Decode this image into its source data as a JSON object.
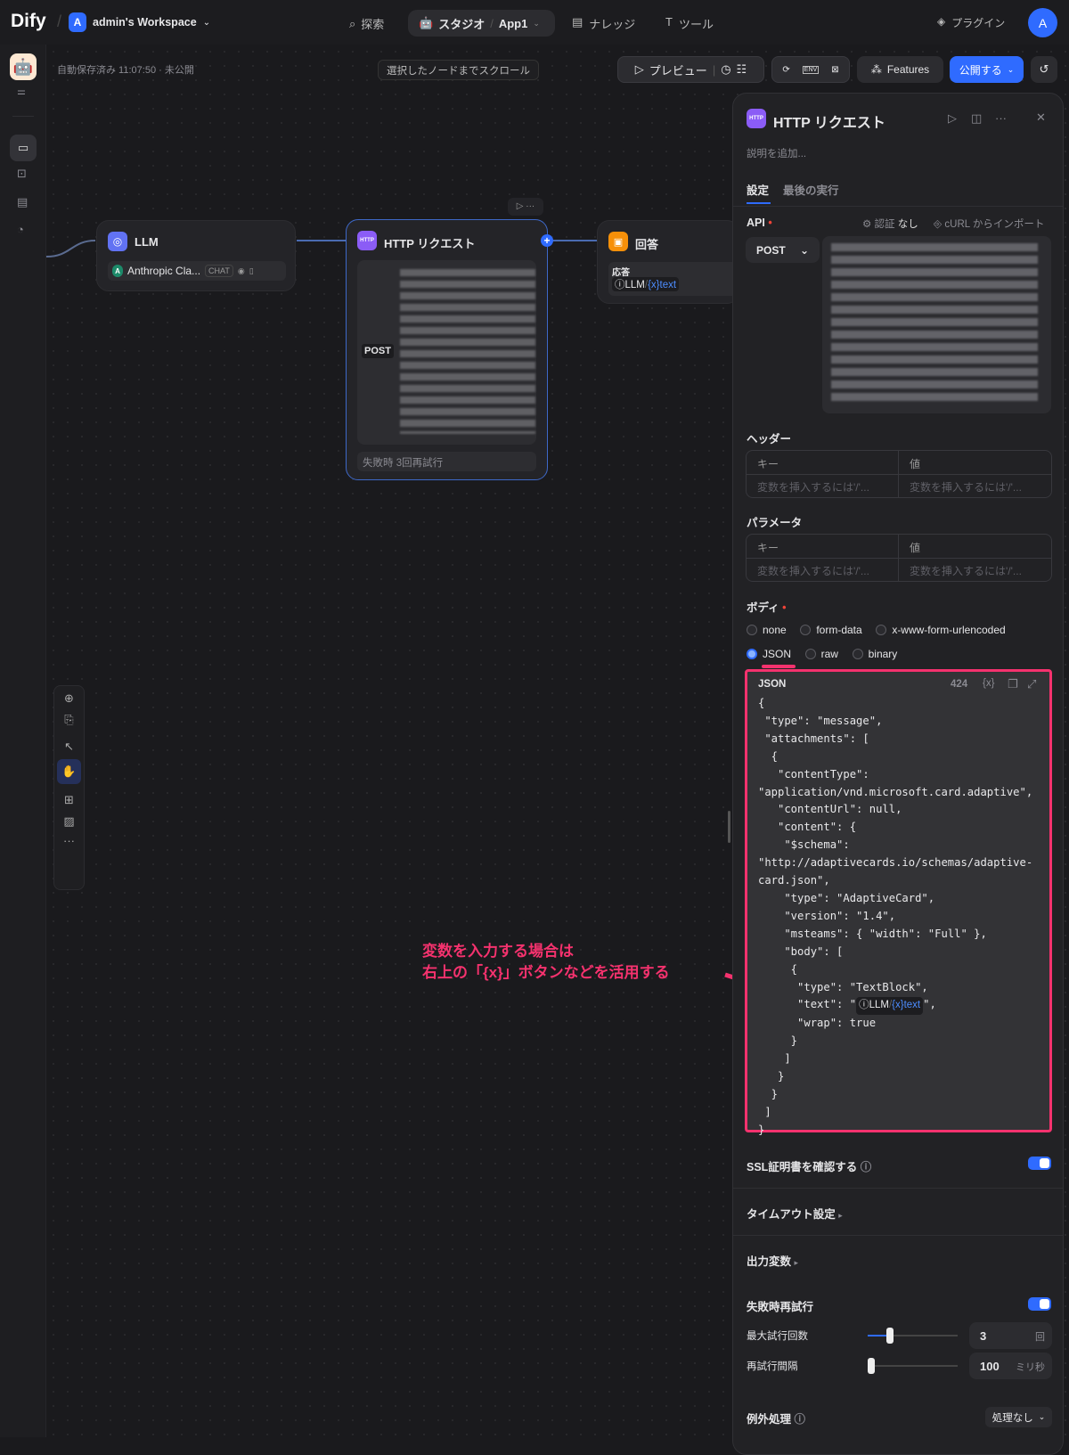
{
  "topbar": {
    "logo": "Dify",
    "workspace_initial": "A",
    "workspace": "admin's Workspace",
    "nav": {
      "explore": "探索",
      "studio": "スタジオ",
      "app": "App1",
      "knowledge": "ナレッジ",
      "tools": "ツール"
    },
    "plugins": "プラグイン",
    "avatar": "A"
  },
  "toolbar": {
    "autosave": "自動保存済み 11:07:50 · 未公開",
    "scroll_btn": "選択したノードまでスクロール",
    "preview": "プレビュー",
    "env": "ENV",
    "features": "Features",
    "publish": "公開する"
  },
  "nodes": {
    "llm": {
      "title": "LLM",
      "model": "Anthropic Cla...",
      "badge": "CHAT"
    },
    "http": {
      "title": "HTTP リクエスト",
      "method": "POST",
      "retry": "失敗時 3回再試行"
    },
    "answer": {
      "title": "回答",
      "label": "応答",
      "var_node": "LLM",
      "var_name": "text"
    }
  },
  "annotation": {
    "line1": "変数を入力する場合は",
    "line2": "右上の「{x}」ボタンなどを活用する"
  },
  "panel": {
    "icon": "HTTP",
    "title": "HTTP リクエスト",
    "desc_placeholder": "説明を追加...",
    "tabs": [
      "設定",
      "最後の実行"
    ],
    "api_label": "API",
    "auth_label": "認証",
    "auth_value": "なし",
    "curl_import": "cURL からインポート",
    "method": "POST",
    "headers": {
      "title": "ヘッダー",
      "key": "キー",
      "value": "値",
      "key_ph": "変数を挿入するには'/'...",
      "value_ph": "変数を挿入するには'/'..."
    },
    "params": {
      "title": "パラメータ",
      "key": "キー",
      "value": "値",
      "key_ph": "変数を挿入するには'/'...",
      "value_ph": "変数を挿入するには'/'..."
    },
    "body": {
      "title": "ボディ",
      "options": [
        "none",
        "form-data",
        "x-www-form-urlencoded",
        "JSON",
        "raw",
        "binary"
      ],
      "selected": "JSON",
      "editor_label": "JSON",
      "char_count": "424",
      "var_btn": "{x}",
      "json_lines": [
        "{",
        " \"type\": \"message\",",
        " \"attachments\": [",
        "  {",
        "   \"contentType\":",
        "\"application/vnd.microsoft.card.adaptive\",",
        "   \"contentUrl\": null,",
        "   \"content\": {",
        "    \"$schema\":",
        "\"http://adaptivecards.io/schemas/adaptive-",
        "card.json\",",
        "    \"type\": \"AdaptiveCard\",",
        "    \"version\": \"1.4\",",
        "    \"msteams\": { \"width\": \"Full\" },",
        "    \"body\": [",
        "     {",
        "      \"type\": \"TextBlock\",",
        "      \"text\": \"",
        "      \"wrap\": true",
        "     }",
        "    ]",
        "   }",
        "  }",
        " ]",
        "}"
      ],
      "text_suffix": "\",",
      "var_node": "LLM",
      "var_name": "text"
    },
    "ssl": "SSL証明書を確認する",
    "ssl_on": true,
    "timeout": "タイムアウト設定",
    "output_vars": "出力変数",
    "retry": {
      "title": "失敗時再試行",
      "enabled": true,
      "max_label": "最大試行回数",
      "max_value": "3",
      "max_unit": "回",
      "interval_label": "再試行間隔",
      "interval_value": "100",
      "interval_unit": "ミリ秒"
    },
    "error": {
      "label": "例外処理",
      "value": "処理なし"
    }
  }
}
